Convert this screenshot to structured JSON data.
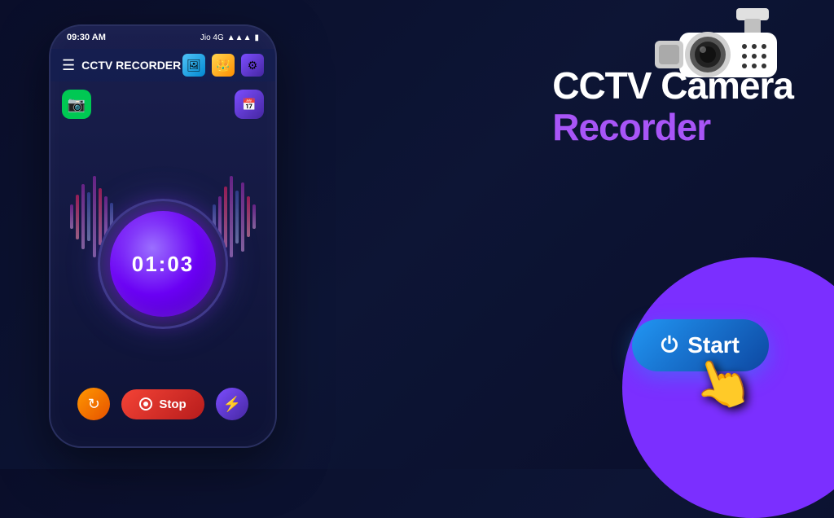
{
  "app": {
    "status_time": "09:30 AM",
    "status_network": "Jio 4G",
    "title": "CCTV RECORDER",
    "timer": "01:03",
    "stop_label": "Stop",
    "start_label": "Start",
    "heading_line1": "CCTV Camera",
    "heading_line2": "Recorder"
  },
  "icons": {
    "menu": "☰",
    "gallery": "🖼",
    "crown": "👑",
    "settings": "⚙",
    "camera_icon": "📷",
    "schedule": "📅",
    "refresh": "↻",
    "flash": "⚡",
    "power": "⏻",
    "stop_dot": "●",
    "signal": "▲▲▲",
    "battery": "🔋",
    "wifi": "▲"
  },
  "colors": {
    "bg_dark": "#0a0e2a",
    "purple_accent": "#a855f7",
    "blue_accent": "#2196f3",
    "stop_red": "#f44336",
    "green": "#00c853",
    "orange": "#ff9800"
  }
}
